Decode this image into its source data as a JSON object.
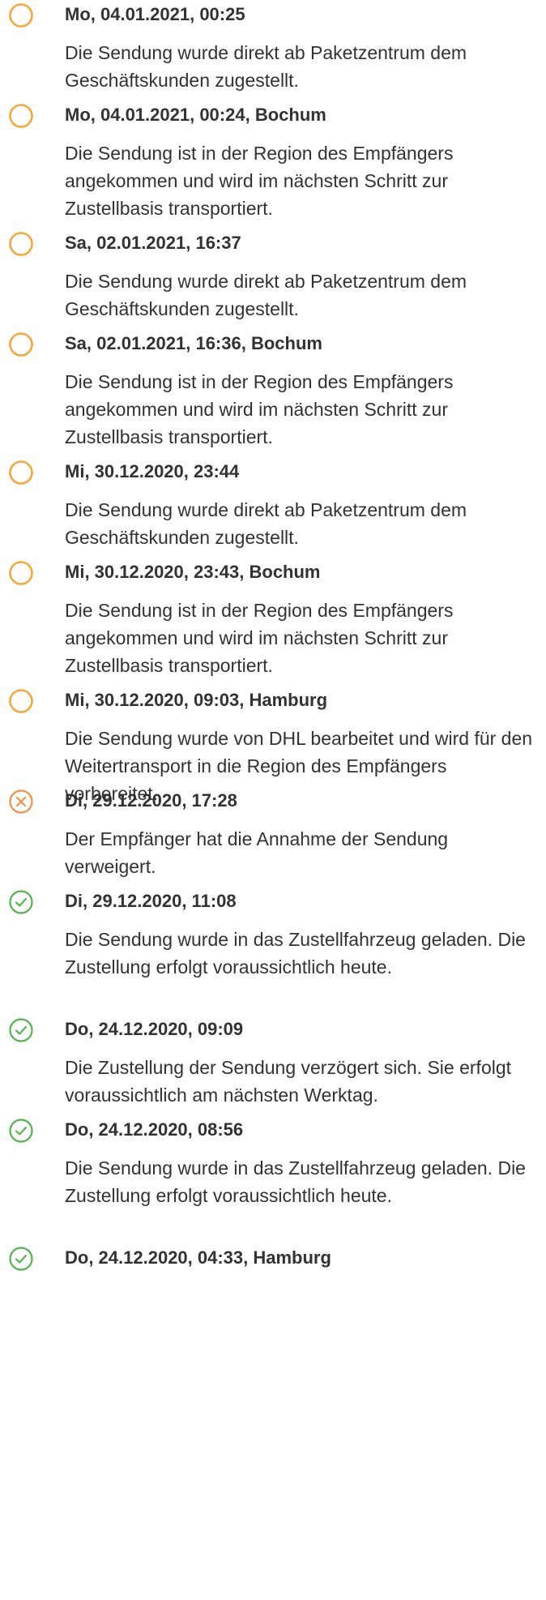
{
  "colors": {
    "pending": "#F7A63D",
    "refused": "#F39044",
    "done": "#52B44C",
    "text": "#323232"
  },
  "events": [
    {
      "status": "pending",
      "icon": "open-circle-icon",
      "date": "Mo, 04.01.2021, 00:25",
      "description": "Die Sendung wurde direkt ab Paketzentrum dem Geschäftskunden zugestellt."
    },
    {
      "status": "pending",
      "icon": "open-circle-icon",
      "date": "Mo, 04.01.2021, 00:24, Bochum",
      "description": "Die Sendung ist in der Region des Empfängers angekommen und wird im nächsten Schritt zur Zustellbasis transportiert."
    },
    {
      "status": "pending",
      "icon": "open-circle-icon",
      "date": "Sa, 02.01.2021, 16:37",
      "description": "Die Sendung wurde direkt ab Paketzentrum dem Geschäftskunden zugestellt."
    },
    {
      "status": "pending",
      "icon": "open-circle-icon",
      "date": "Sa, 02.01.2021, 16:36, Bochum",
      "description": "Die Sendung ist in der Region des Empfängers angekommen und wird im nächsten Schritt zur Zustellbasis transportiert."
    },
    {
      "status": "pending",
      "icon": "open-circle-icon",
      "date": "Mi, 30.12.2020, 23:44",
      "description": "Die Sendung wurde direkt ab Paketzentrum dem Geschäftskunden zugestellt."
    },
    {
      "status": "pending",
      "icon": "open-circle-icon",
      "date": "Mi, 30.12.2020, 23:43, Bochum",
      "description": "Die Sendung ist in der Region des Empfängers angekommen und wird im nächsten Schritt zur Zustellbasis transportiert."
    },
    {
      "status": "pending",
      "icon": "open-circle-icon",
      "date": "Mi, 30.12.2020, 09:03, Hamburg",
      "description": "Die Sendung wurde von DHL bearbeitet und wird für den Weitertransport in die Region des Empfängers vorbereitet."
    },
    {
      "status": "refused",
      "icon": "x-circle-icon",
      "date": "Di, 29.12.2020, 17:28",
      "description": "Der Empfänger hat die Annahme der Sendung verweigert."
    },
    {
      "status": "done",
      "icon": "check-circle-icon",
      "date": "Di, 29.12.2020, 11:08",
      "description": "Die Sendung wurde in das Zustellfahrzeug geladen. Die Zustellung erfolgt voraussichtlich heute."
    },
    {
      "status": "done",
      "icon": "check-circle-icon",
      "date": "Do, 24.12.2020, 09:09",
      "description": "Die Zustellung der Sendung verzögert sich. Sie erfolgt voraussichtlich am nächsten Werktag."
    },
    {
      "status": "done",
      "icon": "check-circle-icon",
      "date": "Do, 24.12.2020, 08:56",
      "description": "Die Sendung wurde in das Zustellfahrzeug geladen. Die Zustellung erfolgt voraussichtlich heute."
    },
    {
      "status": "done",
      "icon": "check-circle-icon",
      "date": "Do, 24.12.2020, 04:33, Hamburg",
      "description": ""
    }
  ]
}
